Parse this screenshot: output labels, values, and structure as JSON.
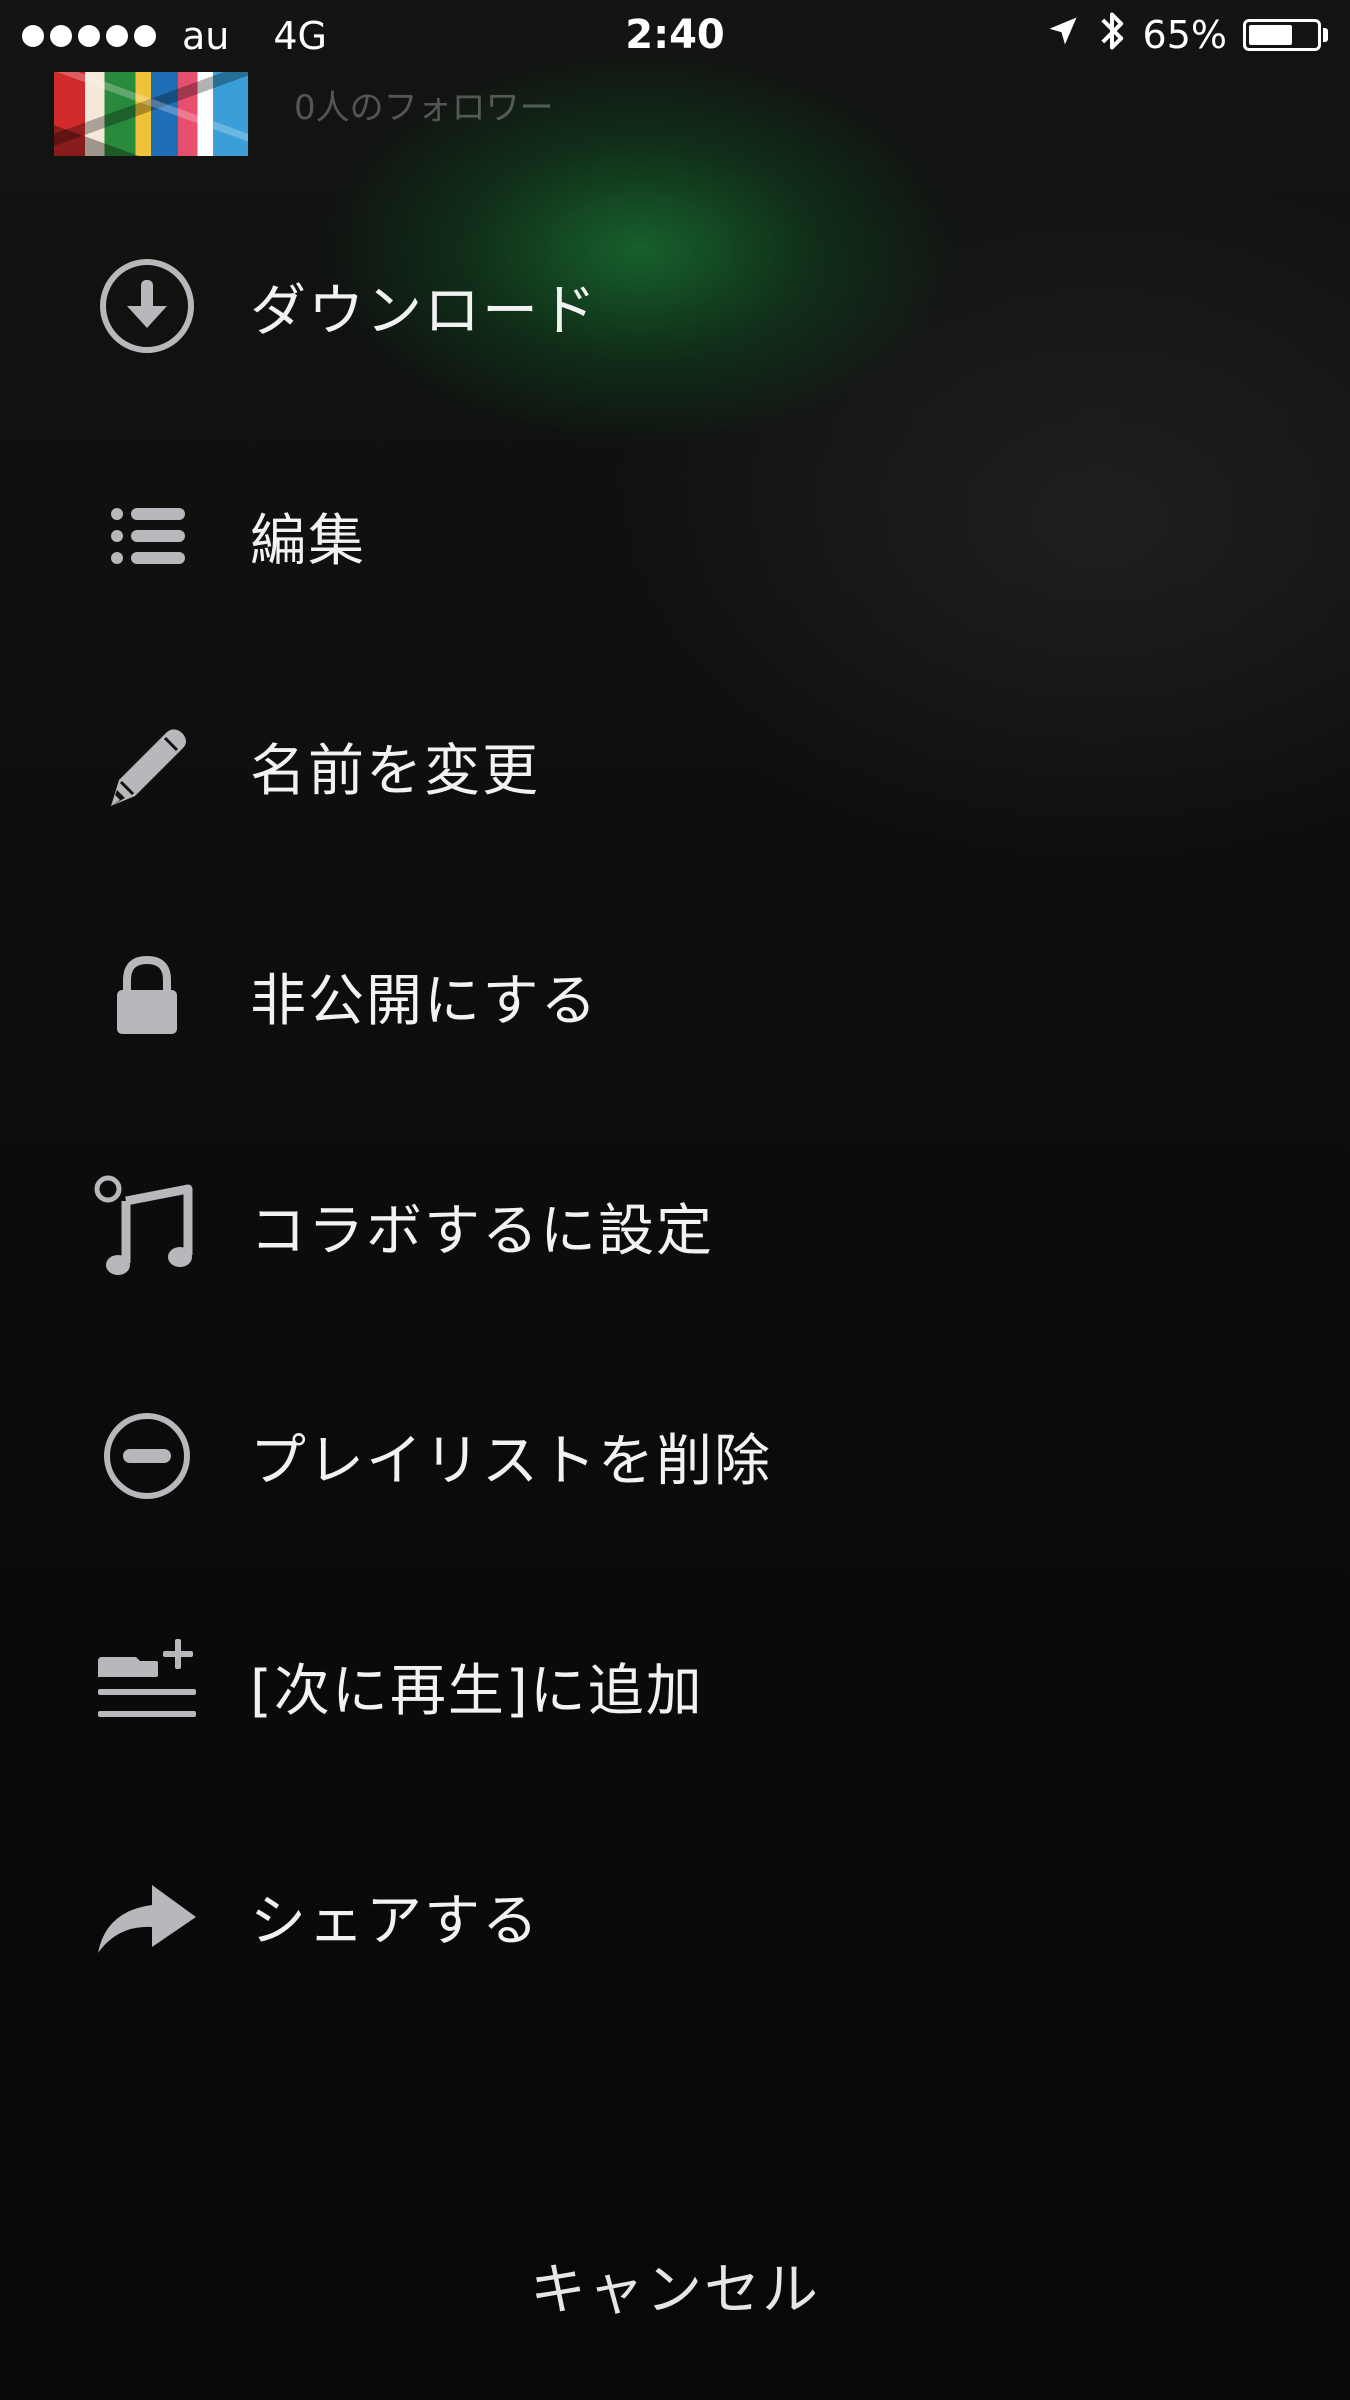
{
  "status_bar": {
    "carrier": "au",
    "network": "4G",
    "time": "2:40",
    "battery_percent_text": "65%",
    "battery_level": 0.65,
    "signal_bars": 5
  },
  "header": {
    "followers": "0人のフォロワー"
  },
  "menu": {
    "items": [
      {
        "label": "ダウンロード",
        "icon": "download-icon"
      },
      {
        "label": "編集",
        "icon": "list-icon"
      },
      {
        "label": "名前を変更",
        "icon": "pencil-icon"
      },
      {
        "label": "非公開にする",
        "icon": "lock-icon"
      },
      {
        "label": "コラボするに設定",
        "icon": "collaborative-music-icon"
      },
      {
        "label": "プレイリストを削除",
        "icon": "minus-circle-icon"
      },
      {
        "label": "[次に再生]に追加",
        "icon": "add-to-queue-icon"
      },
      {
        "label": "シェアする",
        "icon": "share-icon"
      }
    ]
  },
  "cancel": {
    "label": "キャンセル"
  },
  "colors": {
    "icon": "#b8b8bc",
    "accent_green": "#1a6e30",
    "text": "#f2f2f2"
  }
}
